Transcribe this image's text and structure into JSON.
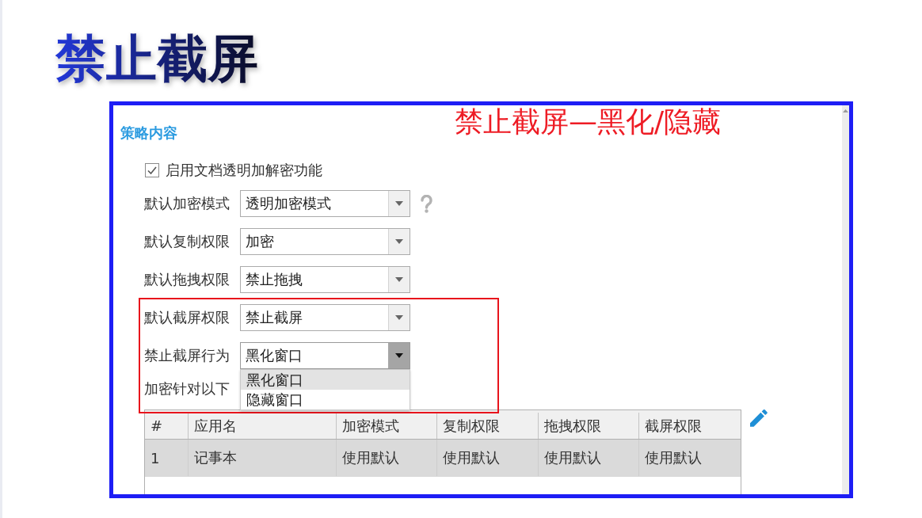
{
  "slide": {
    "title": "禁止截屏"
  },
  "annotation": {
    "text": "禁止截屏—黑化/隐藏",
    "highlight_frame": true
  },
  "panel": {
    "section_title": "策略内容",
    "enable_checkbox": {
      "label": "启用文档透明加解密功能",
      "checked": true
    },
    "fields": [
      {
        "label": "默认加密模式",
        "value": "透明加密模式",
        "help": true,
        "open": false
      },
      {
        "label": "默认复制权限",
        "value": "加密",
        "help": false,
        "open": false
      },
      {
        "label": "默认拖拽权限",
        "value": "禁止拖拽",
        "help": false,
        "open": false
      },
      {
        "label": "默认截屏权限",
        "value": "禁止截屏",
        "help": false,
        "open": false
      },
      {
        "label": "禁止截屏行为",
        "value": "黑化窗口",
        "help": false,
        "open": true,
        "options": [
          {
            "label": "黑化窗口",
            "selected": true
          },
          {
            "label": "隐藏窗口",
            "selected": false
          }
        ]
      }
    ],
    "programs_label": "加密针对以下",
    "table": {
      "columns": [
        "#",
        "应用名",
        "加密模式",
        "复制权限",
        "拖拽权限",
        "截屏权限"
      ],
      "rows": [
        {
          "cells": [
            "1",
            "记事本",
            "使用默认",
            "使用默认",
            "使用默认",
            "使用默认"
          ],
          "selected": true
        }
      ]
    }
  }
}
